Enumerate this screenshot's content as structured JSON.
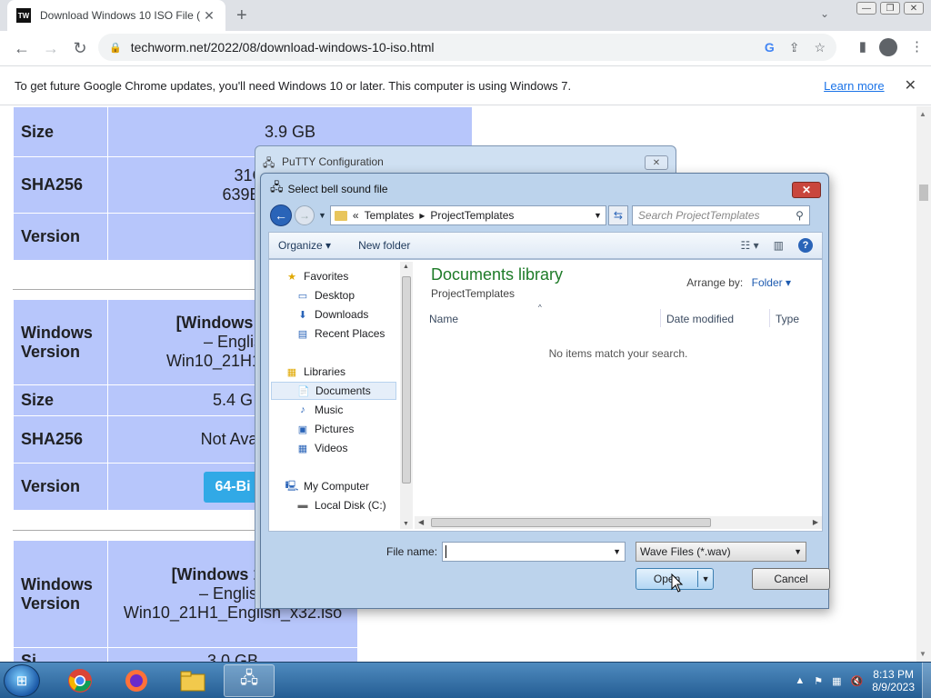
{
  "browser": {
    "tab_title": "Download Windows 10 ISO File (",
    "tab_favicon": "TW",
    "url": "techworm.net/2022/08/download-windows-10-iso.html",
    "infobar_message": "To get future Google Chrome updates, you'll need Windows 10 or later. This computer is using Windows 7.",
    "infobar_link": "Learn more"
  },
  "page": {
    "table1": {
      "size_label": "Size",
      "size_value": "3.9 GB",
      "sha_label": "SHA256",
      "sha_line1": "31C0CE969DE",
      "sha_line2": "639B9649ADB678",
      "version_label": "Version"
    },
    "table2": {
      "wv_label_1": "Windows",
      "wv_label_2": "Version",
      "wv_value_1": "[Windows 10 2",
      "wv_value_2": "– Englis",
      "wv_value_3": "Win10_21H1_Eng",
      "size_label": "Size",
      "size_value": "5.4 G",
      "sha_label": "SHA256",
      "sha_value": "Not Avail",
      "version_label": "Version",
      "button": "64-Bi"
    },
    "table3": {
      "wv_label_1": "Windows",
      "wv_label_2": "Version",
      "wv_value_1": "[Windows 10 21",
      "wv_value_2": "– English",
      "wv_value_3": "Win10_21H1_English_x32.iso",
      "size_label": "Si",
      "size_value": "3.0 GB"
    }
  },
  "putty": {
    "title": "PuTTY Configuration",
    "close": "✕"
  },
  "dialog": {
    "title": "Select bell sound file",
    "close": "✕",
    "breadcrumb": [
      "«",
      "Templates",
      "▸",
      "ProjectTemplates"
    ],
    "search_placeholder": "Search ProjectTemplates",
    "organize": "Organize ▾",
    "new_folder": "New folder",
    "tree": {
      "favorites": "Favorites",
      "desktop": "Desktop",
      "downloads": "Downloads",
      "recent": "Recent Places",
      "libraries": "Libraries",
      "documents": "Documents",
      "music": "Music",
      "pictures": "Pictures",
      "videos": "Videos",
      "computer": "My Computer",
      "local_disk": "Local Disk (C:)"
    },
    "library_title": "Documents library",
    "library_sub": "ProjectTemplates",
    "arrange_label": "Arrange by:",
    "arrange_value": "Folder ▾",
    "columns": {
      "name": "Name",
      "date": "Date modified",
      "type": "Type"
    },
    "empty_message": "No items match your search.",
    "file_name_label": "File name:",
    "file_name_value": "",
    "file_type": "Wave Files (*.wav)",
    "open_label": "Open",
    "cancel_label": "Cancel"
  },
  "taskbar": {
    "time": "8:13 PM",
    "date": "8/9/2023"
  }
}
